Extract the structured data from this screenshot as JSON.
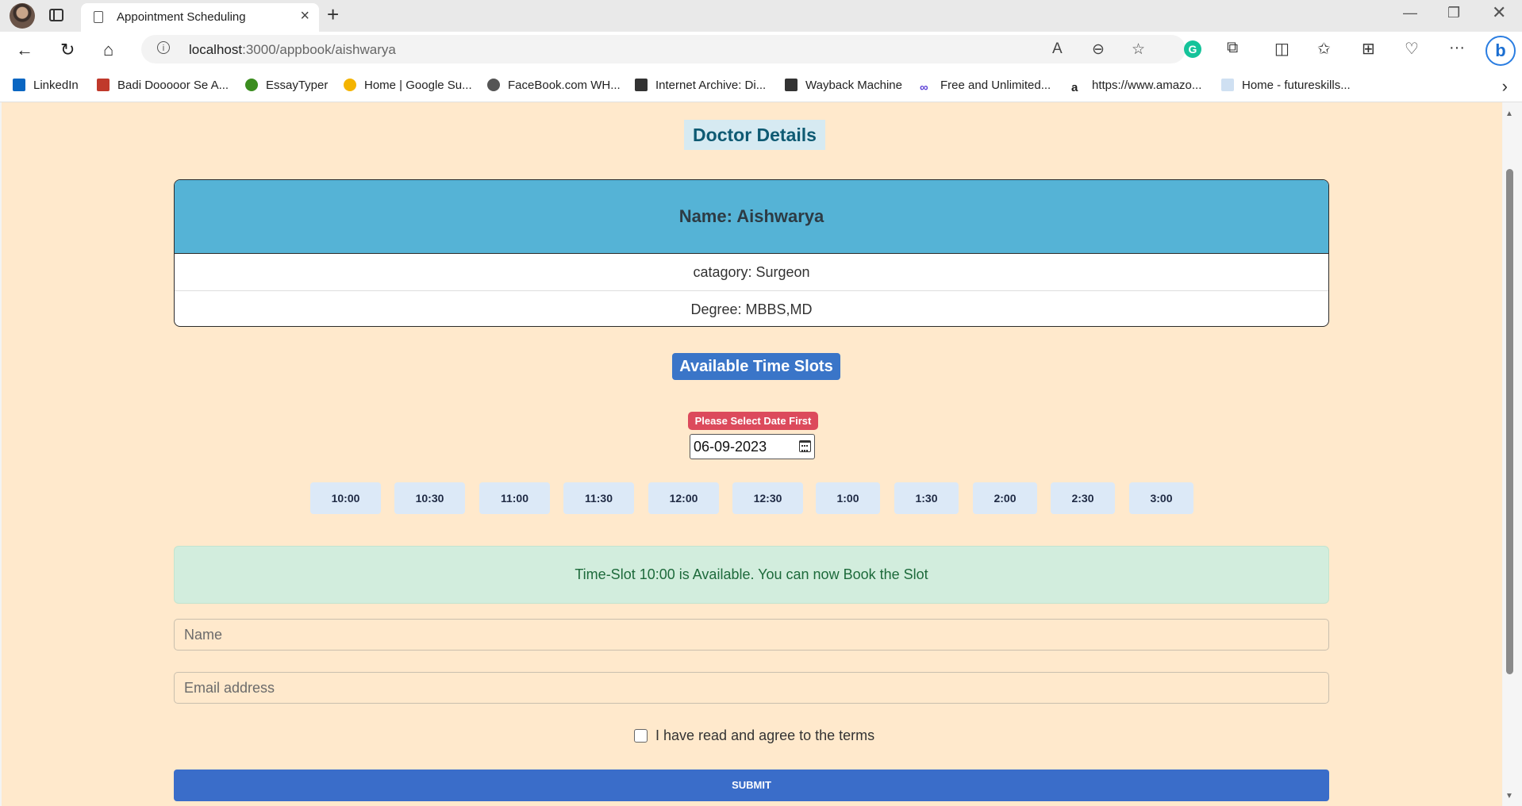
{
  "browser": {
    "tab_title": "Appointment Scheduling",
    "url_host": "localhost",
    "url_path": ":3000/appbook/aishwarya",
    "bookmarks": [
      {
        "label": "LinkedIn",
        "icon": "linkedin-icon",
        "color": "#0a66c2"
      },
      {
        "label": "Badi Dooooor Se A...",
        "icon": "bookmark-icon",
        "color": "#c0392b"
      },
      {
        "label": "EssayTyper",
        "icon": "essaytyper-icon",
        "color": "#3b8d1f"
      },
      {
        "label": "Home | Google Su...",
        "icon": "sun-icon",
        "color": "#f4b400"
      },
      {
        "label": "FaceBook.com WH...",
        "icon": "gear-icon",
        "color": "#555555"
      },
      {
        "label": "Internet Archive: Di...",
        "icon": "archive-icon",
        "color": "#333333"
      },
      {
        "label": "Wayback Machine",
        "icon": "archive-icon",
        "color": "#333333"
      },
      {
        "label": "Free and Unlimited...",
        "icon": "infinity-icon",
        "color": "#5b3fd6"
      },
      {
        "label": "https://www.amazo...",
        "icon": "amazon-icon",
        "color": "#111111"
      },
      {
        "label": "Home - futureskills...",
        "icon": "futureskills-icon",
        "color": "#6aa0d8"
      }
    ]
  },
  "page": {
    "heading": "Doctor Details",
    "doctor": {
      "name": "Name: Aishwarya",
      "category": "catagory: Surgeon",
      "degree": "Degree: MBBS,MD"
    },
    "slots_heading": "Available Time Slots",
    "date_warning": "Please Select Date First",
    "date_value": "06-09-2023",
    "time_slots": [
      "10:00",
      "10:30",
      "11:00",
      "11:30",
      "12:00",
      "12:30",
      "1:00",
      "1:30",
      "2:00",
      "2:30",
      "3:00"
    ],
    "alert_text": "Time-Slot 10:00 is Available. You can now Book the Slot",
    "name_placeholder": "Name",
    "email_placeholder": "Email address",
    "terms_label": "I have read and agree to the terms",
    "submit_label": "SUBMIT"
  },
  "colors": {
    "page_background": "#ffe9cc",
    "card_header": "#55b3d6",
    "primary_button": "#3a6dc9",
    "warning_badge": "#dc4a5c",
    "success_alert": "#d2eddd"
  }
}
